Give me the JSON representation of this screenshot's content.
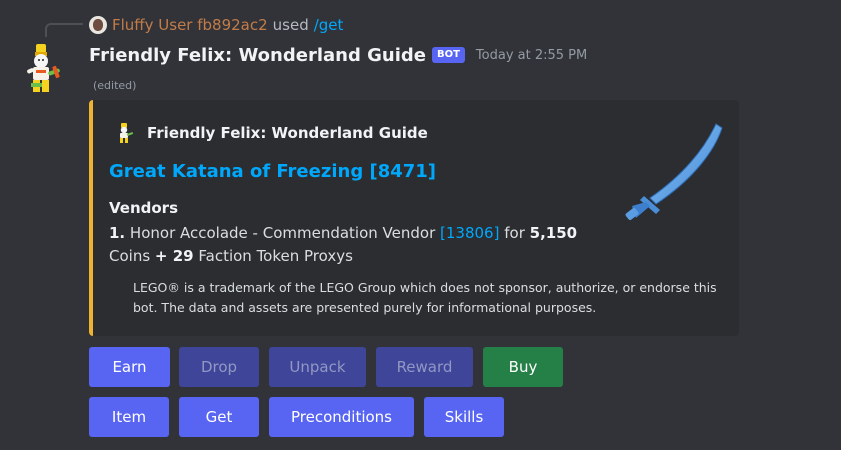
{
  "reply": {
    "username": "Fluffy User fb892ac2",
    "used_text": "used",
    "command": "/get"
  },
  "message": {
    "author": "Friendly Felix: Wonderland Guide",
    "bot_tag": "BOT",
    "timestamp": "Today at 2:55 PM",
    "edited_label": "(edited)"
  },
  "embed": {
    "accent_color": "#f0b232",
    "author_name": "Friendly Felix: Wonderland Guide",
    "title": "Great Katana of Freezing",
    "title_id": "[8471]",
    "field_name": "Vendors",
    "vendor": {
      "index": "1.",
      "name": "Honor Accolade - Commendation Vendor",
      "id": "[13806]",
      "for_text": "for",
      "coins_amount": "5,150",
      "coins_label": "Coins",
      "plus": "+ 29",
      "extra_label": "Faction Token Proxys"
    },
    "footer": "LEGO® is a trademark of the LEGO Group which does not sponsor, authorize, or endorse this bot. The data and assets are presented purely for informational purposes.",
    "thumbnail_icon": "katana-icon"
  },
  "buttons_row1": [
    {
      "label": "Earn",
      "style": "primary"
    },
    {
      "label": "Drop",
      "style": "disabled"
    },
    {
      "label": "Unpack",
      "style": "disabled"
    },
    {
      "label": "Reward",
      "style": "disabled"
    },
    {
      "label": "Buy",
      "style": "success"
    }
  ],
  "buttons_row2": [
    {
      "label": "Item",
      "style": "primary"
    },
    {
      "label": "Get",
      "style": "primary"
    },
    {
      "label": "Preconditions",
      "style": "primary"
    },
    {
      "label": "Skills",
      "style": "primary"
    }
  ],
  "colors": {
    "background": "#313338",
    "embed_background": "#2b2d31",
    "link": "#00a8fc",
    "primary_button": "#5865f2",
    "success_button": "#248046",
    "disabled_button": "#3f469a"
  }
}
